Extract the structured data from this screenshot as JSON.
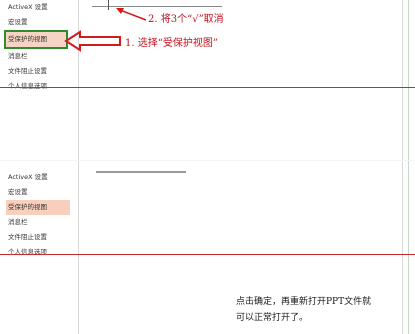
{
  "screens": [
    {
      "sidebar": [
        {
          "label": "ActiveX 设置"
        },
        {
          "label": "宏设置"
        },
        {
          "label": "受保护的视图"
        },
        {
          "label": "消息栏"
        },
        {
          "label": "文件阻止设置"
        },
        {
          "label": "个人信息选项"
        }
      ],
      "annotations": {
        "step1": "1. 选择“受保护视图”",
        "step2": "2. 将3个“√”取消"
      }
    },
    {
      "sidebar": [
        {
          "label": "ActiveX 设置"
        },
        {
          "label": "宏设置"
        },
        {
          "label": "受保护的视图"
        },
        {
          "label": "消息栏"
        },
        {
          "label": "文件阻止设置"
        },
        {
          "label": "个人信息选项"
        }
      ],
      "annotations": {
        "note_line1": "点击确定，再重新打开PPT文件就",
        "note_line2": "可以正常打开了。"
      }
    }
  ],
  "colors": {
    "annotation_red": "#c1121f",
    "selection_box_green": "#2e8b2e",
    "selection_fill": "#f6d4c3",
    "divider_red": "#c72a2a"
  }
}
